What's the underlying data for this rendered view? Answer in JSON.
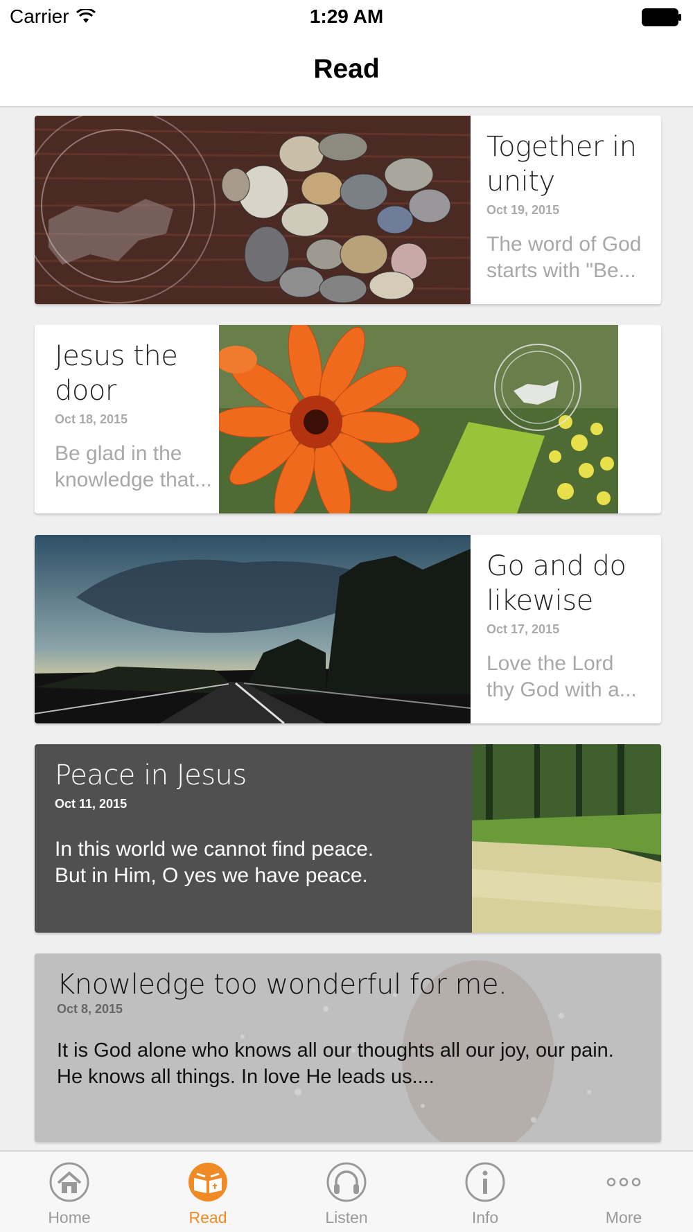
{
  "status_bar": {
    "carrier": "Carrier",
    "time": "1:29 AM"
  },
  "nav": {
    "title": "Read"
  },
  "cards": [
    {
      "title": "Together in unity",
      "date": "Oct 19, 2015",
      "excerpt_line1": "The word of God",
      "excerpt_line2": "starts with \"Be..."
    },
    {
      "title": "Jesus the door",
      "date": "Oct 18, 2015",
      "excerpt_line1": "Be glad in the",
      "excerpt_line2": "knowledge that..."
    },
    {
      "title": "Go and do likewise",
      "date": "Oct 17, 2015",
      "excerpt_line1": "Love the Lord",
      "excerpt_line2": "thy God with a..."
    },
    {
      "title": "Peace in Jesus",
      "date": "Oct 11, 2015",
      "excerpt_line1": "In this world we cannot find peace.",
      "excerpt_line2": "But in Him, O yes we have peace."
    },
    {
      "title": "Knowledge too wonderful for me.",
      "date": "Oct 8, 2015",
      "excerpt_line1": "It is God alone who knows all our thoughts all our joy, our pain.",
      "excerpt_line2": "He knows all things. In love He leads us...."
    }
  ],
  "tab_bar": {
    "tabs": [
      {
        "label": "Home",
        "icon": "home-icon",
        "active": false
      },
      {
        "label": "Read",
        "icon": "open-book-icon",
        "active": true
      },
      {
        "label": "Listen",
        "icon": "headphones-icon",
        "active": false
      },
      {
        "label": "Info",
        "icon": "info-icon",
        "active": false
      },
      {
        "label": "More",
        "icon": "more-dots-icon",
        "active": false
      }
    ],
    "active_color": "#f08a24",
    "inactive_color": "#999999"
  }
}
